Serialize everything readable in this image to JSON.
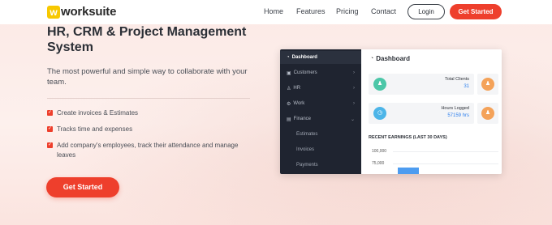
{
  "brand": {
    "logo_letter": "w",
    "name": "worksuite",
    "logo_color": "#f7c800"
  },
  "nav": {
    "links": [
      "Home",
      "Features",
      "Pricing",
      "Contact"
    ],
    "login_label": "Login",
    "cta_label": "Get Started"
  },
  "hero": {
    "title": "HR, CRM & Project Management System",
    "subtitle": "The most powerful and simple way to collaborate with your team.",
    "features": [
      "Create invoices & Estimates",
      "Tracks time and expenses",
      "Add company's employees, track their attendance and manage leaves"
    ],
    "cta_label": "Get Started"
  },
  "dashboard": {
    "sidebar": [
      {
        "icon": "dashboard-icon",
        "label": "Dashboard",
        "active": true
      },
      {
        "icon": "customers-icon",
        "label": "Customers"
      },
      {
        "icon": "hr-icon",
        "label": "HR"
      },
      {
        "icon": "work-icon",
        "label": "Work"
      },
      {
        "icon": "finance-icon",
        "label": "Finance"
      }
    ],
    "finance_sub": [
      "Estimates",
      "Invoices",
      "Payments"
    ],
    "title": "Dashboard",
    "stats": [
      {
        "label": "Total Clients",
        "value": "31",
        "icon_color": "#4cc7a8"
      },
      {
        "label": "Hours Logged",
        "value": "57159 hrs",
        "icon_color": "#4db5e8"
      }
    ],
    "side_icon_color": "#f4a259",
    "earnings_title": "RECENT EARNINGS (LAST 30 DAYS)",
    "earnings_ticks": [
      "100,000",
      "75,000"
    ]
  },
  "colors": {
    "accent": "#ee3f2c",
    "value_blue": "#2f80ed",
    "sidebar_bg": "#1f2430"
  }
}
